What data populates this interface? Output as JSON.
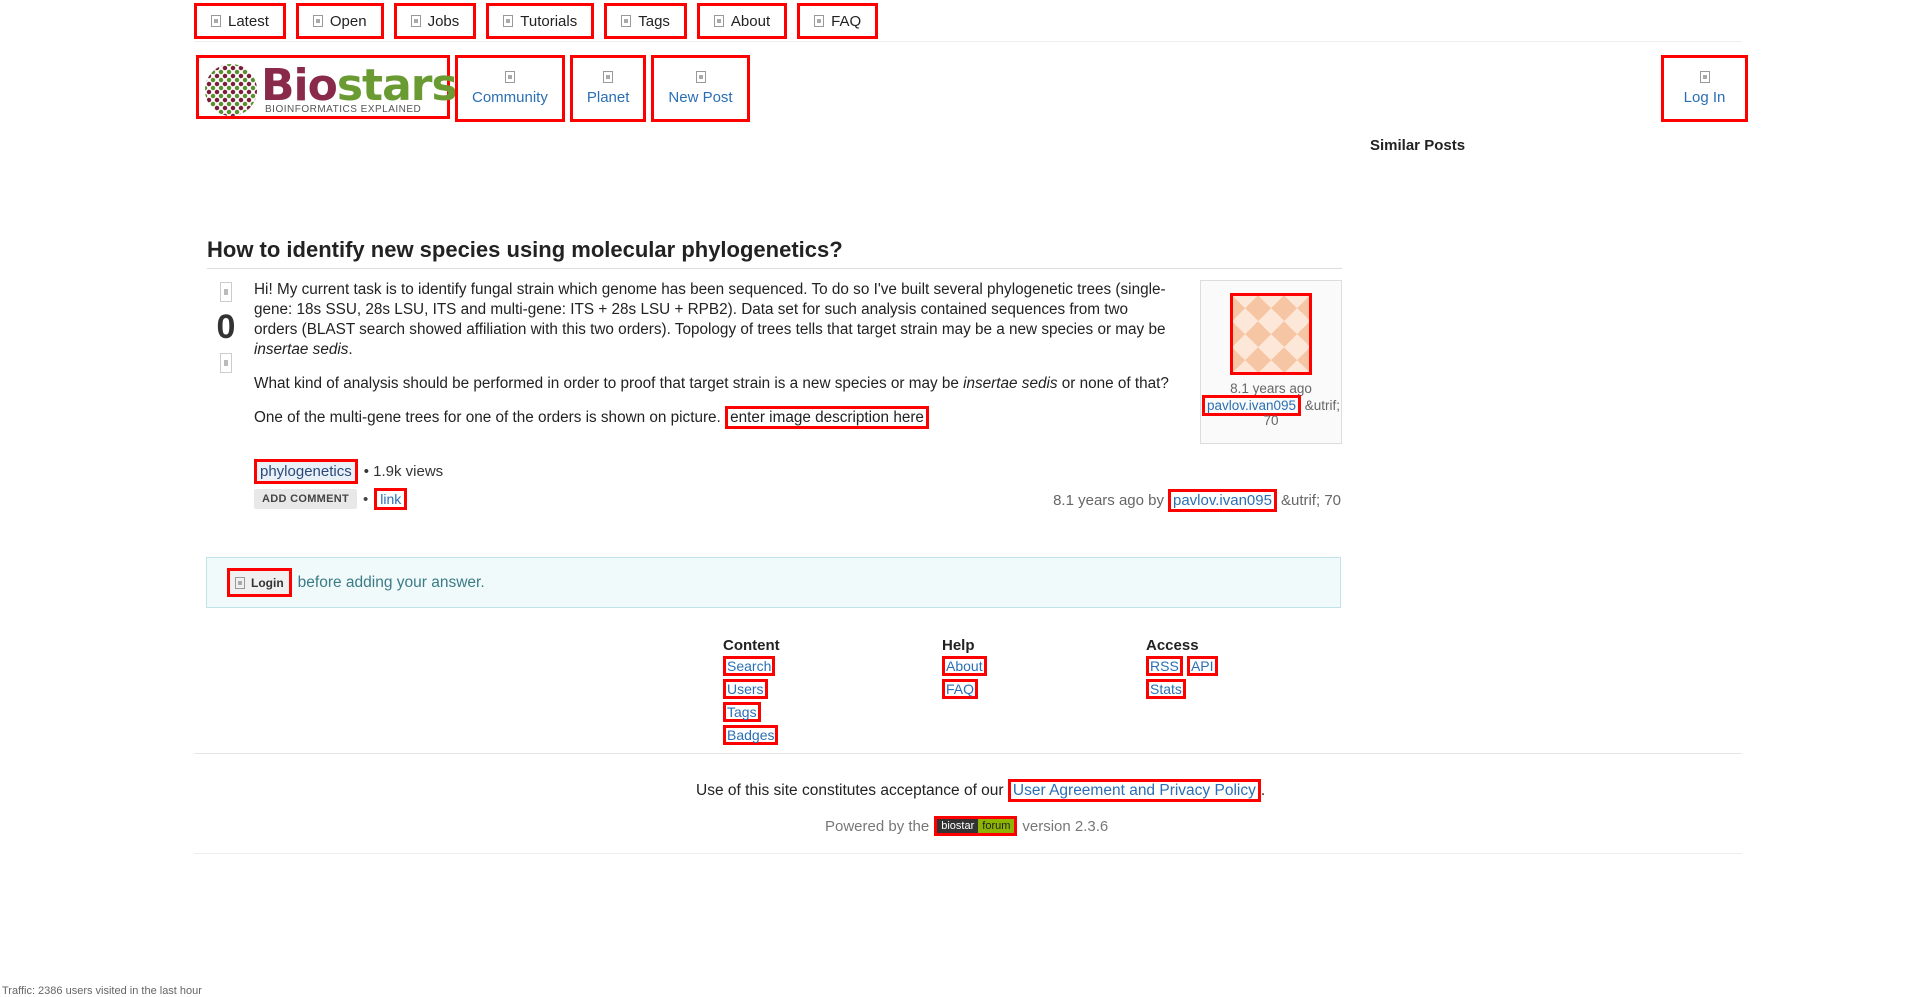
{
  "topnav": [
    {
      "label": "Latest",
      "icon": "latest-icon"
    },
    {
      "label": "Open",
      "icon": "open-icon"
    },
    {
      "label": "Jobs",
      "icon": "jobs-icon"
    },
    {
      "label": "Tutorials",
      "icon": "tutorials-icon"
    },
    {
      "label": "Tags",
      "icon": "tags-icon"
    },
    {
      "label": "About",
      "icon": "about-icon"
    },
    {
      "label": "FAQ",
      "icon": "faq-icon"
    }
  ],
  "logo": {
    "part1": "Bio",
    "part2": "stars",
    "tagline": "BIOINFORMATICS EXPLAINED"
  },
  "mainnav": [
    {
      "label": "Community",
      "icon": "community-icon"
    },
    {
      "label": "Planet",
      "icon": "planet-icon"
    },
    {
      "label": "New Post",
      "icon": "new-post-icon"
    }
  ],
  "login_top": "Log In",
  "similar_posts": "Similar Posts",
  "question": {
    "title": "How to identify new species using molecular phylogenetics?",
    "votes": "0",
    "p1_a": "Hi! My current task is to identify fungal strain which genome has been sequenced. To do so I've built several phylogenetic trees (single-gene: 18s SSU, 28s LSU, ITS and multi-gene: ITS + 28s LSU + RPB2). Data set for such analysis contained sequences from two orders (BLAST search showed affiliation with this two orders). Topology of trees tells that target strain may be a new species or may be ",
    "p1_em": "insertae sedis",
    "p1_end": ".",
    "p2_a": "What kind of analysis should be performed in order to proof that target strain is a new species or may be ",
    "p2_em": "insertae sedis",
    "p2_end": " or none of that?",
    "p3_a": "One of the multi-gene trees for one of the orders is shown on picture. ",
    "p3_link": "enter image description here",
    "tag": "phylogenetics",
    "views": "• 1.9k views",
    "add_comment": "ADD COMMENT",
    "link": "link",
    "byline_time": "8.1 years ago by",
    "byline_user": "pavlov.ivan095",
    "byline_rep": "&utrif; 70"
  },
  "usercard": {
    "time": "8.1 years ago",
    "user": "pavlov.ivan095",
    "rep": "&utrif; 70"
  },
  "answer_notice": {
    "login": "Login",
    "text": "before adding your answer."
  },
  "footer": {
    "content": {
      "heading": "Content",
      "links": [
        "Search",
        "Users",
        "Tags",
        "Badges"
      ]
    },
    "help": {
      "heading": "Help",
      "links": [
        "About",
        "FAQ"
      ]
    },
    "access": {
      "heading": "Access",
      "links": [
        "RSS",
        "API",
        "Stats"
      ]
    },
    "accept_text": "Use of this site constitutes acceptance of our ",
    "accept_link": "User Agreement and Privacy Policy",
    "accept_end": ".",
    "powered_pre": "Powered by the",
    "badge_a": "biostar",
    "badge_b": "forum",
    "powered_post": "version 2.3.6"
  },
  "traffic": "Traffic: 2386 users visited in the last hour"
}
